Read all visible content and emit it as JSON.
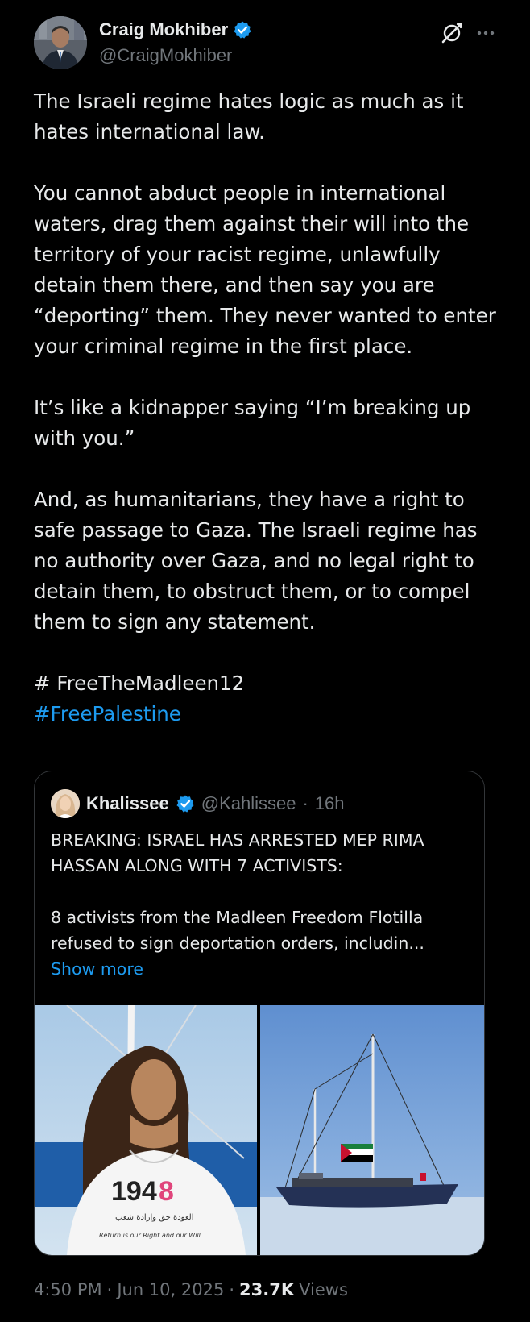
{
  "author": {
    "name": "Craig Mokhiber",
    "handle": "@CraigMokhiber",
    "verified": true
  },
  "post": {
    "paragraphs": [
      "The Israeli regime hates logic as much as it hates international law.",
      "You cannot abduct people in international waters, drag them against their will into the territory of your racist regime, unlawfully detain them there, and then say you are “deporting” them. They never wanted to enter your criminal regime in the first place.",
      "It’s like a kidnapper saying “I’m breaking up with you.”",
      "And, as humanitarians, they have a right to safe passage to Gaza. The Israeli regime has no authority over Gaza, and no legal right to detain them, to obstruct them, or to compel them to sign any statement."
    ],
    "hashtag_plain": "# FreeTheMadleen12",
    "hashtag_link": "#FreePalestine"
  },
  "quote": {
    "author": "Khalissee",
    "handle": "@Kahlissee",
    "dot": "·",
    "time": "16h",
    "paragraphs": [
      "BREAKING: ISRAEL HAS ARRESTED MEP RIMA HASSAN ALONG WITH 7 ACTIVISTS:",
      "8 activists from the Madleen Freedom Flotilla refused to sign deportation orders, includin..."
    ],
    "show_more": "Show more",
    "shirt_number_black": "194",
    "shirt_number_pink": "8",
    "shirt_line_arabic": "العودة حق وإرادة شعب",
    "shirt_line_english": "Return is our Right and our Will"
  },
  "footer": {
    "time": "4:50 PM",
    "dot1": "·",
    "date": "Jun 10, 2025",
    "dot2": "·",
    "views_count": "23.7K",
    "views_label": "Views"
  },
  "colors": {
    "background": "#000000",
    "text": "#e7e9ea",
    "secondary": "#71767b",
    "accent": "#1d9bf0",
    "border": "#333639"
  },
  "icons": [
    "verified-badge-icon",
    "grok-icon",
    "more-options-icon"
  ]
}
